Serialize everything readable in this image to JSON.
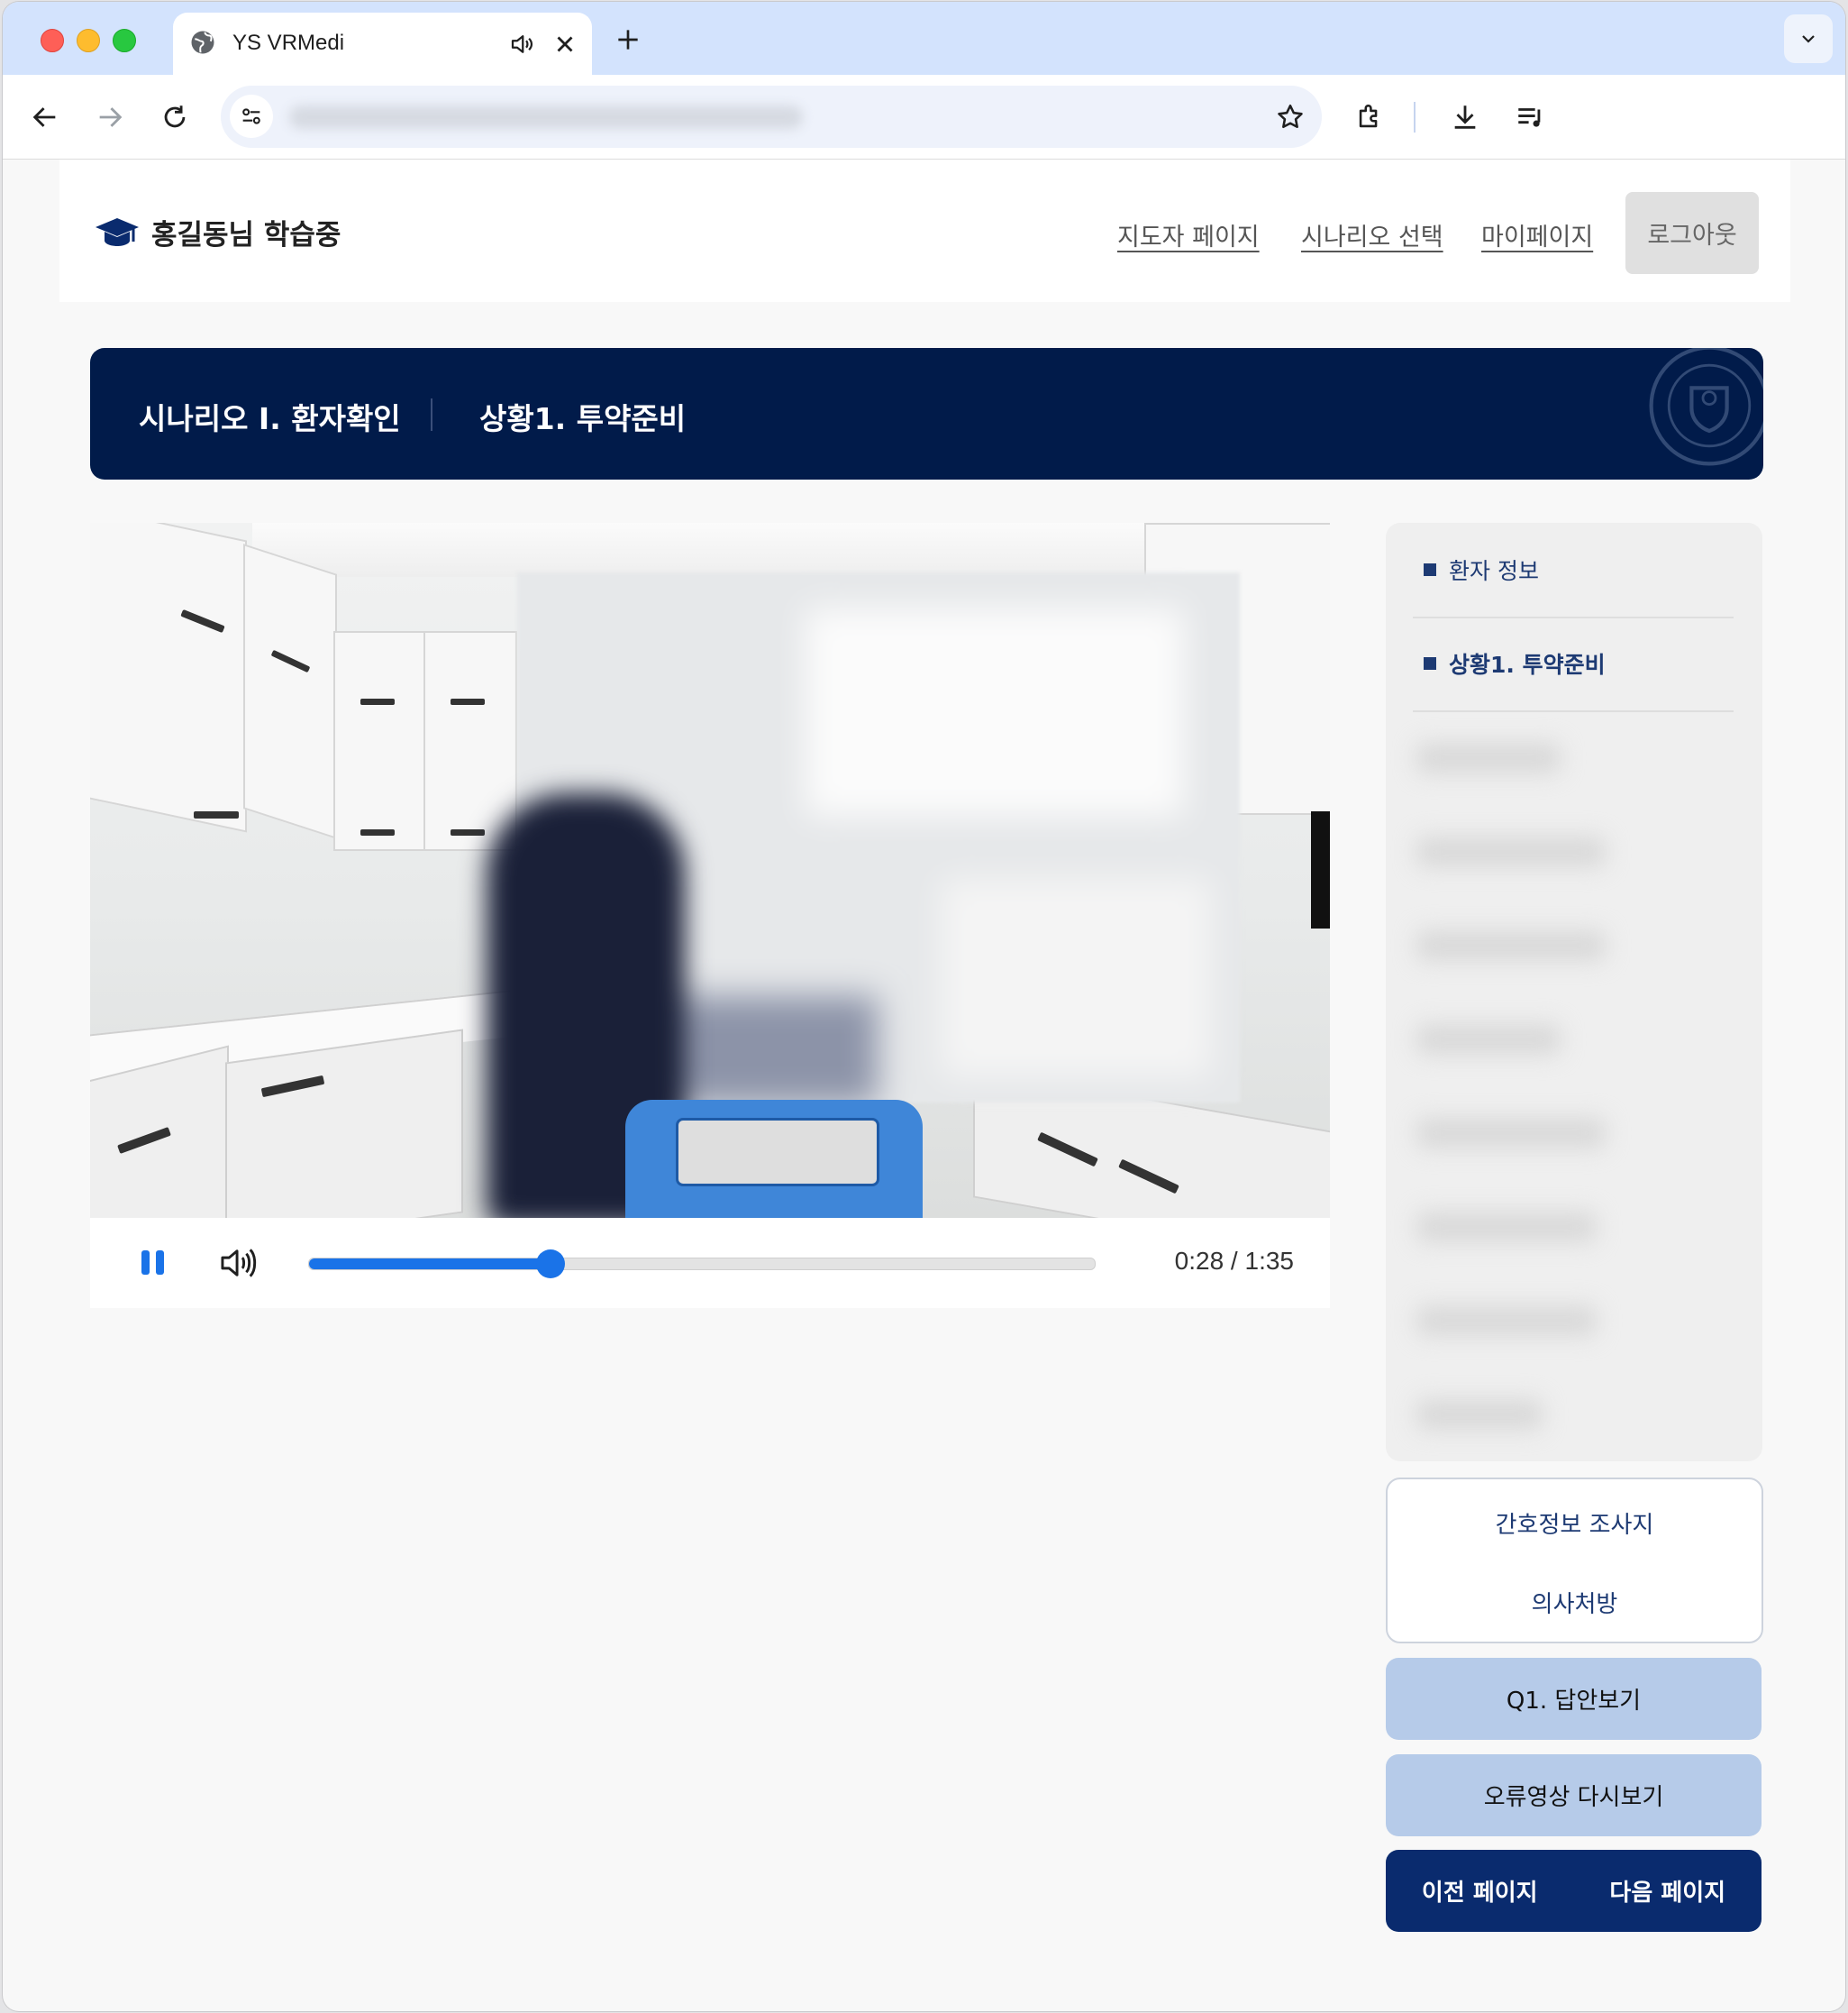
{
  "browser": {
    "tab_title": "YS VRMedi",
    "accent": "#d3e3fd"
  },
  "site": {
    "brand": "홍길동님 학습중",
    "nav": [
      "지도자 페이지",
      "시나리오 선택",
      "마이페이지"
    ],
    "logout": "로그아웃"
  },
  "scenario": {
    "title": "시나리오 I. 환자확인",
    "situation": "상황1. 투약준비",
    "bar_color": "#011b4a"
  },
  "player": {
    "time": "0:28 / 1:35",
    "progress": 0.307
  },
  "sidebar": {
    "items": [
      {
        "label": "환자 정보"
      },
      {
        "label": "상황1. 투약준비"
      }
    ]
  },
  "documents": {
    "nursing_sheet": "간호정보 조사지",
    "prescription": "의사처방"
  },
  "actions": {
    "answer": "Q1. 답안보기",
    "replay_error": "오류영상 다시보기",
    "prev": "이전 페이지",
    "next": "다음 페이지"
  }
}
